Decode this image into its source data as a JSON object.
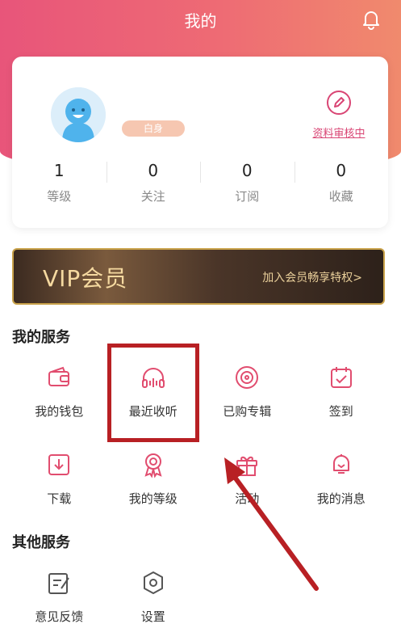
{
  "header": {
    "title": "我的"
  },
  "profile": {
    "badge": "白身",
    "edit_label": "资料审核中",
    "stats": [
      {
        "value": "1",
        "label": "等级"
      },
      {
        "value": "0",
        "label": "关注"
      },
      {
        "value": "0",
        "label": "订阅"
      },
      {
        "value": "0",
        "label": "收藏"
      }
    ]
  },
  "vip": {
    "title": "VIP会员",
    "link": "加入会员畅享特权>"
  },
  "my_services": {
    "title": "我的服务",
    "items": [
      {
        "label": "我的钱包",
        "icon": "wallet-icon"
      },
      {
        "label": "最近收听",
        "icon": "headphones-icon"
      },
      {
        "label": "已购专辑",
        "icon": "album-icon"
      },
      {
        "label": "签到",
        "icon": "calendar-check-icon"
      },
      {
        "label": "下载",
        "icon": "download-icon"
      },
      {
        "label": "我的等级",
        "icon": "medal-icon"
      },
      {
        "label": "活动",
        "icon": "gift-icon"
      },
      {
        "label": "我的消息",
        "icon": "message-bell-icon"
      }
    ]
  },
  "other_services": {
    "title": "其他服务",
    "items": [
      {
        "label": "意见反馈",
        "icon": "feedback-icon"
      },
      {
        "label": "设置",
        "icon": "settings-icon"
      }
    ]
  },
  "theme": {
    "accent": "#e8557a",
    "icon_color": "#e14d6f",
    "annotation": "#b82024"
  }
}
